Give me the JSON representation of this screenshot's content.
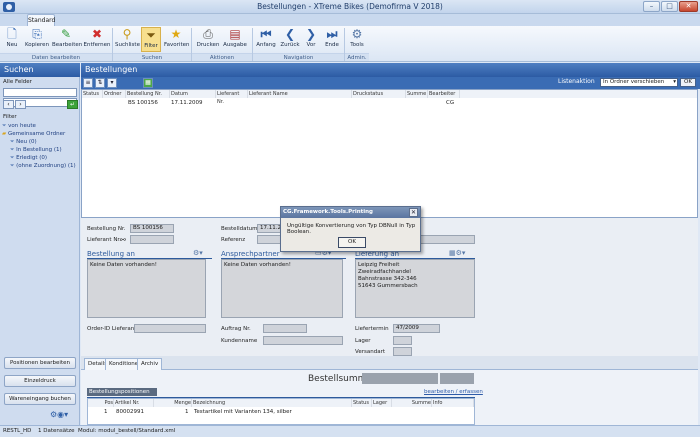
{
  "window": {
    "title": "Bestellungen - XTreme Bikes (Demofirma V 2018)"
  },
  "ribbon": {
    "tab": "Standard",
    "buttons": [
      {
        "label": "Neu",
        "icon": "new-document-icon"
      },
      {
        "label": "Kopieren",
        "icon": "copy-icon"
      },
      {
        "label": "Bearbeiten",
        "icon": "pencil-icon"
      },
      {
        "label": "Entfernen",
        "icon": "delete-x-icon"
      },
      {
        "label": "Suchliste",
        "icon": "magnifier-icon"
      },
      {
        "label": "Filter",
        "icon": "filter-icon"
      },
      {
        "label": "Favoriten",
        "icon": "star-icon"
      },
      {
        "label": "Drucken",
        "icon": "print-icon"
      },
      {
        "label": "Ausgabe",
        "icon": "output-icon"
      },
      {
        "label": "Anfang",
        "icon": "first-icon"
      },
      {
        "label": "Zurück",
        "icon": "prev-icon"
      },
      {
        "label": "Vor",
        "icon": "next-icon"
      },
      {
        "label": "Ende",
        "icon": "last-icon"
      },
      {
        "label": "Tools",
        "icon": "tools-icon"
      }
    ],
    "groups": [
      "Daten bearbeiten",
      "Suchen",
      "Aktionen",
      "Navigation",
      "Admin."
    ]
  },
  "left": {
    "title": "Suchen",
    "alle_felder": "Alle Felder",
    "filter_label": "Filter",
    "tree": [
      "von heute",
      "Gemeinsame Ordner",
      "Neu (0)",
      "In Bestellung (1)",
      "Erledigt (0)",
      "(ohne Zuordnung) (1)"
    ],
    "buttons": [
      "Positionen bearbeiten",
      "Einzeldruck",
      "Wareneingang buchen"
    ]
  },
  "main": {
    "title": "Bestellungen",
    "listenaktion_label": "Listenaktion",
    "listenaktion_value": "In Ordner verschieben",
    "ok": "OK",
    "columns": [
      "Status",
      "Ordner",
      "Bestellung Nr.",
      "Datum",
      "Lieferant Nr.",
      "Lieferant Name",
      "Druckstatus",
      "Summe",
      "Bearbeiter"
    ],
    "rows": [
      [
        "",
        "",
        "BS 100156",
        "17.11.2009",
        "",
        "",
        "",
        "",
        "CG"
      ]
    ]
  },
  "detail": {
    "bestellung_nr_label": "Bestellung Nr.",
    "bestellung_nr": "BS 100156",
    "lieferant_nr_label": "Lieferant Nr.",
    "bestelldatum_label": "Bestelldatum",
    "bestelldatum": "17.11.2",
    "referenz_label": "Referenz",
    "bestellung_an": "Bestellung an",
    "ansprechpartner": "Ansprechpartner",
    "lieferung_an": "Lieferung an",
    "keine_daten": "Keine Daten vorhanden!",
    "keine_daten2": "Keine Daten vorhanden!",
    "lieferadresse": [
      "Leipzig Freiheit",
      "Zweiradfachhandel",
      "Bahnstrasse 342-346",
      "51643 Gummersbach"
    ],
    "order_id_label": "Order-ID Lieferant",
    "auftrag_label": "Auftrag Nr.",
    "kundenname_label": "Kundenname",
    "liefertermin_label": "Liefertermin",
    "liefertermin": "47/2009",
    "lager_label": "Lager",
    "versandart_label": "Versandart"
  },
  "dialog": {
    "title": "CG.Framework.Tools.Printing",
    "message": "Ungültige Konvertierung von Typ DBNull in Typ Boolean.",
    "ok": "OK"
  },
  "tabs": [
    "Details",
    "Konditionen",
    "Archiv"
  ],
  "positions": {
    "bestellsumme_label": "Bestellsumme:",
    "section_title": "Bestellungspositionen",
    "edit_link": "bearbeiten / erfassen",
    "columns": [
      "Pos",
      "Artikel Nr.",
      "Menge",
      "Bezeichnung",
      "Status",
      "Lager",
      "Summe",
      "Info"
    ],
    "rows": [
      [
        "1",
        "80002991",
        "1",
        "Testartikel mit Varianten 134, silber"
      ]
    ]
  },
  "statusbar": {
    "db": "RESTL_HD",
    "count": "1 Datensätze",
    "modul": "Modul: modul_bestell/Standard.xml"
  }
}
